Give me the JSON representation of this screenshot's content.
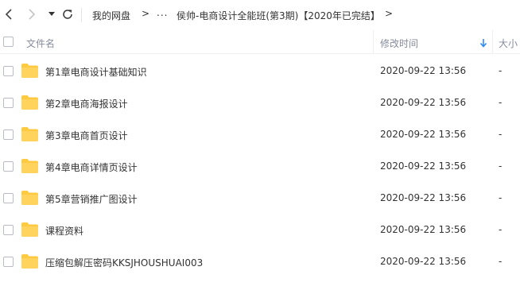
{
  "breadcrumb": {
    "root": "我的网盘",
    "separator": ">",
    "ellipsis": "...",
    "current": "侯帅-电商设计全能班(第3期)【2020年已完结】",
    "trailing_separator": ">"
  },
  "columns": {
    "name": "文件名",
    "modified": "修改时间",
    "size": "大小"
  },
  "colors": {
    "folder": "#ffc940",
    "sort_arrow": "#2f8bf5",
    "header_text": "#878c9c"
  },
  "files": [
    {
      "name": "第1章电商设计基础知识",
      "modified": "2020-09-22 13:56",
      "size": "-"
    },
    {
      "name": "第2章电商海报设计",
      "modified": "2020-09-22 13:56",
      "size": "-"
    },
    {
      "name": "第3章电商首页设计",
      "modified": "2020-09-22 13:56",
      "size": "-"
    },
    {
      "name": "第4章电商详情页设计",
      "modified": "2020-09-22 13:56",
      "size": "-"
    },
    {
      "name": "第5章营销推广图设计",
      "modified": "2020-09-22 13:56",
      "size": "-"
    },
    {
      "name": "课程资料",
      "modified": "2020-09-22 13:56",
      "size": "-"
    },
    {
      "name": "压缩包解压密码KKSJHOUSHUAI003",
      "modified": "2020-09-22 13:56",
      "size": "-"
    }
  ]
}
